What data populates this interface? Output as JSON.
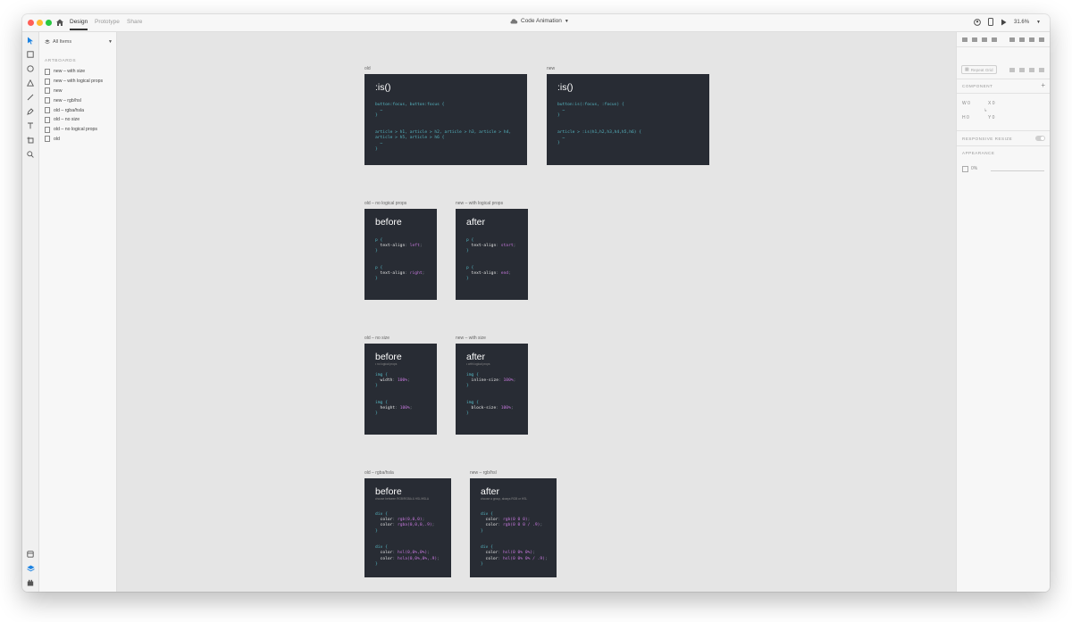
{
  "titlebar": {
    "tabs": [
      {
        "label": "Design",
        "active": true
      },
      {
        "label": "Prototype",
        "active": false
      },
      {
        "label": "Share",
        "active": false
      }
    ],
    "doc_title": "Code Animation",
    "zoom": "31.6%"
  },
  "layers_panel": {
    "filter_label": "All Items",
    "section_label": "ARTBOARDS",
    "items": [
      "new – with size",
      "new – with logical props",
      "new",
      "new – rgb/hsl",
      "old – rgba/hsla",
      "old – no size",
      "old – no logical props",
      "old"
    ]
  },
  "inspector": {
    "repeat_grid_label": "Repeat Grid",
    "component_label": "COMPONENT",
    "w_label": "W",
    "w_value": "0",
    "x_label": "X",
    "x_value": "0",
    "h_label": "H",
    "h_value": "0",
    "y_label": "Y",
    "y_value": "0",
    "responsive_label": "RESPONSIVE RESIZE",
    "appearance_label": "APPEARANCE",
    "opacity_value": "0%"
  },
  "artboards": {
    "old": {
      "label": "old",
      "title": ":is()",
      "code": [
        "button:focus, button:focus {",
        "  …",
        "}",
        "",
        "",
        "article > h1, article > h2, article > h3, article > h4,",
        "article > h5, article > h6 {",
        "  …",
        "}"
      ]
    },
    "new": {
      "label": "new",
      "title": ":is()",
      "code": [
        "button:is(:focus, :focus) {",
        "  …",
        "}",
        "",
        "",
        "article > :is(h1,h2,h3,h4,h5,h6) {",
        "  …",
        "}"
      ]
    },
    "old_no_logical_props": {
      "label": "old – no logical props",
      "title": "before",
      "code": [
        "p {",
        "  text-align: left;",
        "}",
        "",
        "",
        "p {",
        "  text-align: right;",
        "}"
      ]
    },
    "new_with_logical_props": {
      "label": "new – with logical props",
      "title": "after",
      "code": [
        "p {",
        "  text-align: start;",
        "}",
        "",
        "",
        "p {",
        "  text-align: end;",
        "}"
      ]
    },
    "old_no_size": {
      "label": "old – no size",
      "title": "before",
      "subtitle": "• no logical props",
      "code": [
        "img {",
        "  width: 100%;",
        "}",
        "",
        "",
        "img {",
        "  height: 100%;",
        "}"
      ]
    },
    "new_with_size": {
      "label": "new – with size",
      "title": "after",
      "subtitle": "• with logical props",
      "code": [
        "img {",
        "  inline-size: 100%;",
        "}",
        "",
        "",
        "img {",
        "  block-size: 100%;",
        "}"
      ]
    },
    "old_rgba_hsla": {
      "label": "old – rgba/hsla",
      "title": "before",
      "subtitle": "choose between RGB/RGBA & HSL/HSLA",
      "code": [
        "div {",
        "  color: rgb(0,0,0);",
        "  color: rgba(0,0,0,.9);",
        "}",
        "",
        "",
        "div {",
        "  color: hsl(0,0%,0%);",
        "  color: hsla(0,0%,0%,.9);",
        "}"
      ]
    },
    "new_rgb_hsl": {
      "label": "new – rgb/hsl",
      "title": "after",
      "subtitle": "choose a group, always RGB or HSL",
      "code": [
        "div {",
        "  color: rgb(0 0 0);",
        "  color: rgb(0 0 0 / .9);",
        "}",
        "",
        "",
        "div {",
        "  color: hsl(0 0% 0%);",
        "  color: hsl(0 0% 0% / .9);",
        "}"
      ]
    }
  }
}
